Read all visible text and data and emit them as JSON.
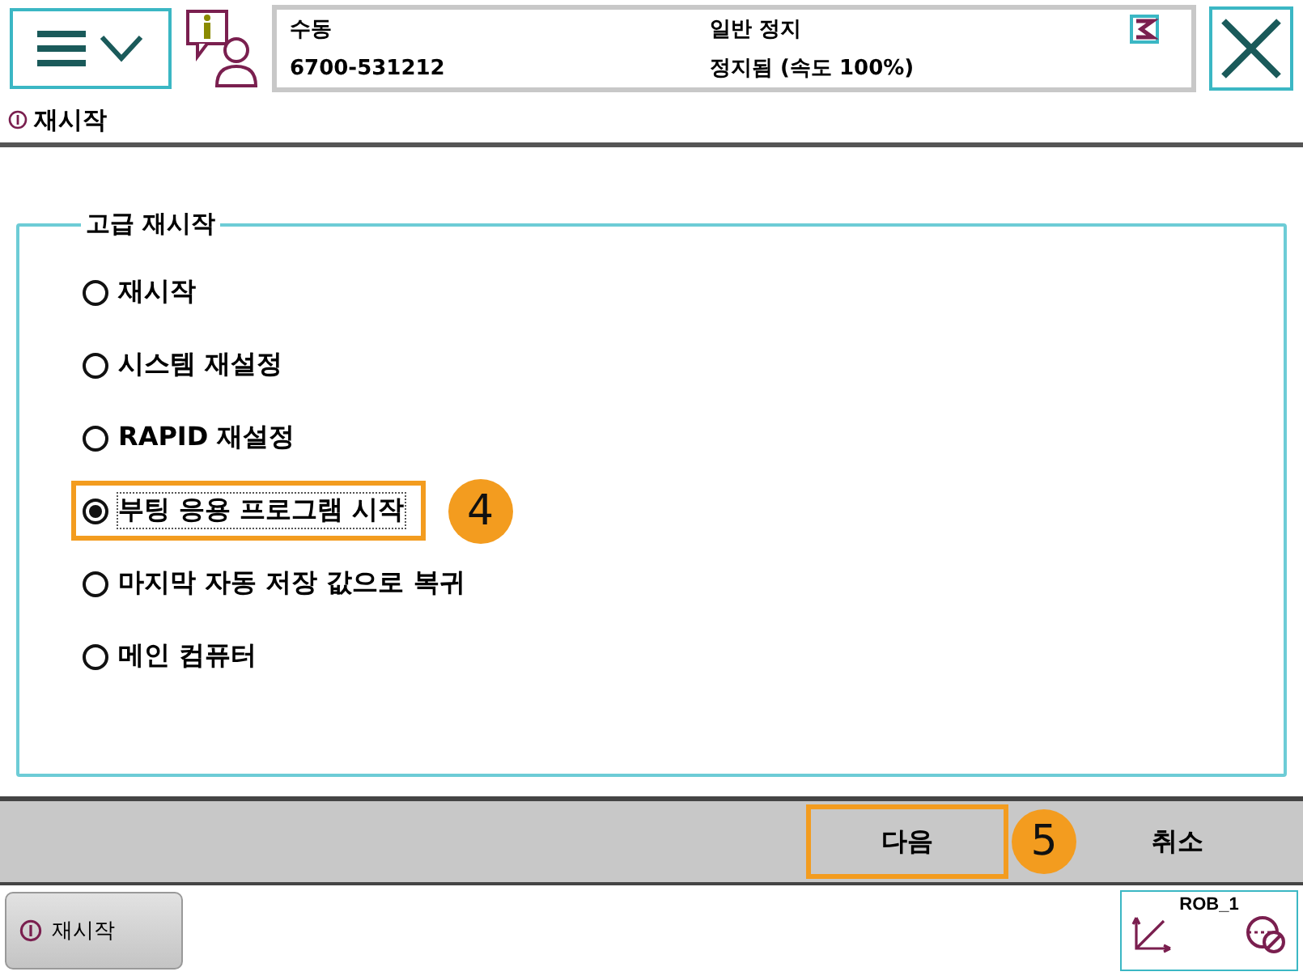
{
  "header": {
    "mode": "수동",
    "system": "6700-531212",
    "state": "일반 정지",
    "speed": "정지됨 (속도 100%)"
  },
  "title": "재시작",
  "group": {
    "legend": "고급 재시작",
    "options": [
      {
        "label": "재시작",
        "selected": false,
        "highlighted": false
      },
      {
        "label": "시스템 재설정",
        "selected": false,
        "highlighted": false
      },
      {
        "label": "RAPID 재설정",
        "selected": false,
        "highlighted": false
      },
      {
        "label": "부팅 응용 프로그램 시작",
        "selected": true,
        "highlighted": true,
        "callout": "4"
      },
      {
        "label": "마지막 자동 저장 값으로 복귀",
        "selected": false,
        "highlighted": false
      },
      {
        "label": "메인 컴퓨터",
        "selected": false,
        "highlighted": false
      }
    ]
  },
  "buttons": [
    {
      "label": "다음",
      "highlighted": true,
      "callout": "5"
    },
    {
      "label": "취소",
      "highlighted": false
    }
  ],
  "taskbar": {
    "app": "재시작",
    "robot": "ROB_1"
  }
}
